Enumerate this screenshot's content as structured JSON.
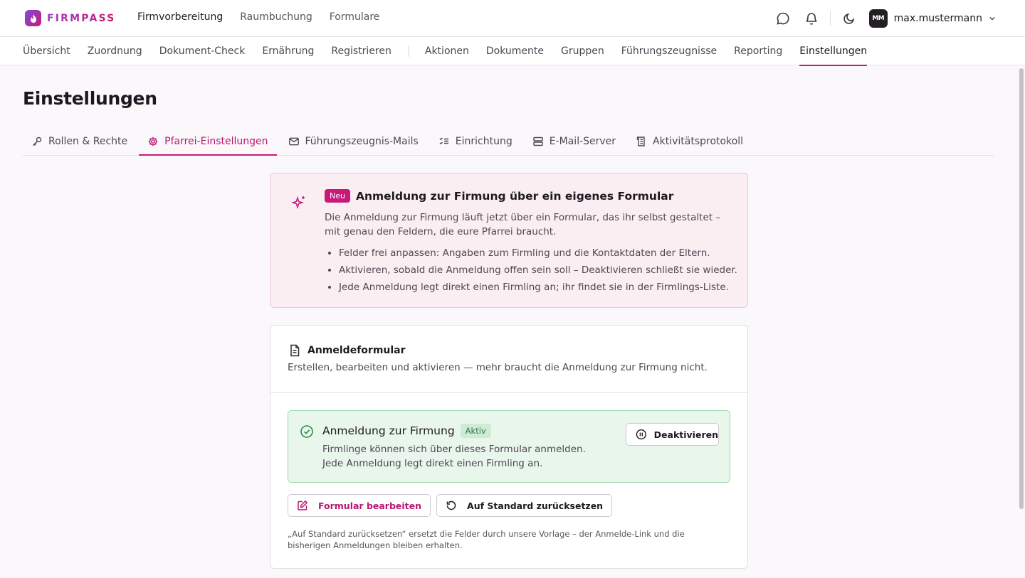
{
  "brand": {
    "name": "FIRMPASS",
    "accent": "#c8197a"
  },
  "mainnav": [
    {
      "label": "Firmvorbereitung",
      "active": true
    },
    {
      "label": "Raumbuchung",
      "active": false
    },
    {
      "label": "Formulare",
      "active": false
    }
  ],
  "user": {
    "initials": "MM",
    "name": "max.mustermann"
  },
  "subnav": {
    "group1": [
      "Übersicht",
      "Zuordnung",
      "Dokument-Check",
      "Ernährung",
      "Registrieren"
    ],
    "group2": [
      "Aktionen",
      "Dokumente",
      "Gruppen",
      "Führungszeugnisse",
      "Reporting",
      "Einstellungen"
    ]
  },
  "page": {
    "title": "Einstellungen"
  },
  "tabs": [
    {
      "label": "Rollen & Rechte",
      "icon": "key-icon"
    },
    {
      "label": "Pfarrei-Einstellungen",
      "icon": "gear-icon"
    },
    {
      "label": "Führungszeugnis-Mails",
      "icon": "mail-icon"
    },
    {
      "label": "Einrichtung",
      "icon": "checklist-icon"
    },
    {
      "label": "E-Mail-Server",
      "icon": "server-icon"
    },
    {
      "label": "Aktivitätsprotokoll",
      "icon": "log-icon"
    }
  ],
  "announcement": {
    "badge": "Neu",
    "title": "Anmeldung zur Firmung über ein eigenes Formular",
    "description": "Die Anmeldung zur Firmung läuft jetzt über ein Formular, das ihr selbst gestaltet – mit genau den Feldern, die eure Pfarrei braucht.",
    "bullets": [
      "Felder frei anpassen: Angaben zum Firmling und die Kontaktdaten der Eltern.",
      "Aktivieren, sobald die Anmeldung offen sein soll – Deaktivieren schließt sie wieder.",
      "Jede Anmeldung legt direkt einen Firmling an; ihr findet sie in der Firmlings-Liste."
    ]
  },
  "form_card": {
    "title": "Anmeldeformular",
    "subtitle": "Erstellen, bearbeiten und aktivieren — mehr braucht die Anmeldung zur Firmung nicht.",
    "status": {
      "title": "Anmeldung zur Firmung",
      "badge": "Aktiv",
      "description": "Firmlinge können sich über dieses Formular anmelden. Jede Anmeldung legt direkt einen Firmling an.",
      "deactivate_label": "Deaktivieren"
    },
    "edit_label": "Formular bearbeiten",
    "reset_label": "Auf Standard zurücksetzen",
    "footnote": "„Auf Standard zurücksetzen“ ersetzt die Felder durch unsere Vorlage – der Anmelde-Link und die bisherigen Anmeldungen bleiben erhalten."
  }
}
